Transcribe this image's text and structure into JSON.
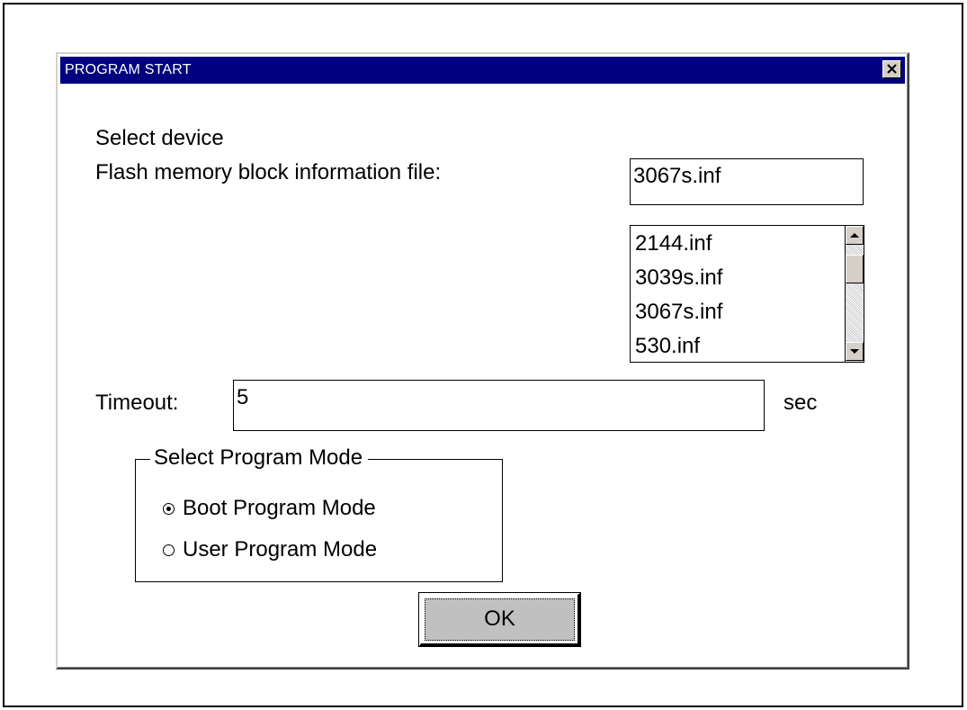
{
  "window": {
    "title": "PROGRAM START",
    "close_glyph": "✕"
  },
  "device": {
    "heading": "Select device",
    "file_label": "Flash memory block information file:",
    "file_value": "3067s.inf",
    "list_items": [
      "2144.inf",
      "3039s.inf",
      "3067s.inf",
      "530.inf"
    ]
  },
  "timeout": {
    "label": "Timeout:",
    "value": "5",
    "unit": "sec"
  },
  "program_mode": {
    "title": "Select Program Mode",
    "options": [
      {
        "label": "Boot Program Mode",
        "checked": true
      },
      {
        "label": "User Program Mode",
        "checked": false
      }
    ]
  },
  "ok_label": "OK",
  "icons": {
    "close": "close-icon",
    "scroll_up": "scroll-up-arrow-icon",
    "scroll_down": "scroll-down-arrow-icon"
  }
}
